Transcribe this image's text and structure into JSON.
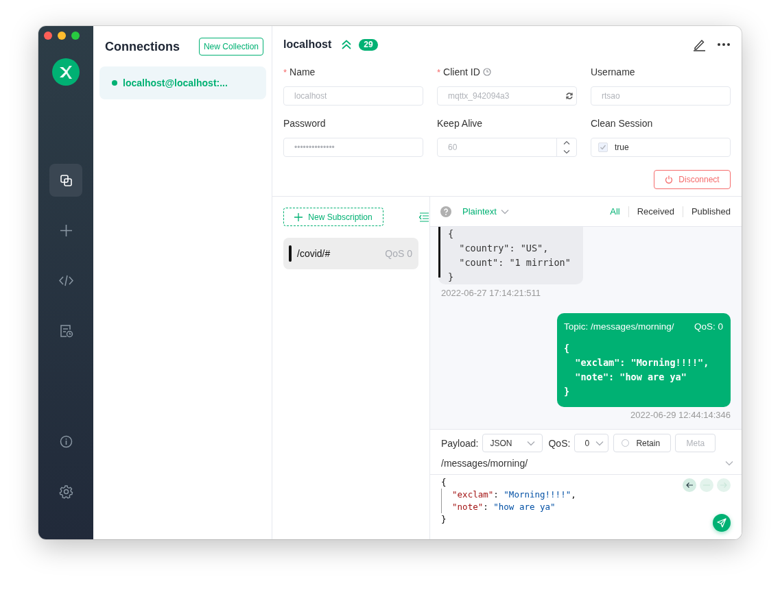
{
  "sidebar": {
    "nav": [
      {
        "selected": true
      },
      {
        "selected": false
      },
      {
        "selected": false
      },
      {
        "selected": false
      }
    ],
    "bottom": [
      {
        "selected": false
      },
      {
        "selected": false
      }
    ]
  },
  "connections": {
    "title": "Connections",
    "new_button": "New Collection",
    "items": [
      {
        "label": "localhost@localhost:...",
        "selected": true,
        "connected": true
      }
    ]
  },
  "connection": {
    "title": "localhost",
    "count": "29",
    "fields": [
      {
        "kind": "text",
        "required_mark": "*",
        "label": "Name",
        "value": "localhost",
        "disabled": true
      },
      {
        "kind": "client-id",
        "required_mark": "*",
        "label": "Client ID",
        "value": "mqttx_942094a3",
        "disabled": true
      },
      {
        "kind": "text",
        "label": "Username",
        "value": "rtsao",
        "disabled": true
      },
      {
        "kind": "text",
        "label": "Password",
        "value": "••••••••••••••",
        "disabled": true
      },
      {
        "kind": "number",
        "label": "Keep Alive",
        "value": "60",
        "disabled": true
      },
      {
        "kind": "checkbox",
        "label": "Clean Session",
        "value": "true",
        "checked": true,
        "disabled": true
      }
    ],
    "disconnect_button": "Disconnect"
  },
  "subscriptions": {
    "new_button": "New Subscription",
    "items": [
      {
        "topic": "/covid/#",
        "qos": "QoS 0",
        "color": "#111111",
        "selected": true
      }
    ]
  },
  "messages": {
    "format": "Plaintext",
    "filters": [
      {
        "label": "All",
        "selected": true
      },
      {
        "label": "Received",
        "selected": false
      },
      {
        "label": "Published",
        "selected": false
      }
    ],
    "items": [
      {
        "kind": "received",
        "payload": "{\n  \"country\": \"US\",\n  \"count\": \"1 mirrion\"\n}",
        "time": "2022-06-27 17:14:21:511"
      },
      {
        "kind": "sent",
        "topic": "Topic: /messages/morning/",
        "qos": "QoS: 0",
        "payload": "{\n  \"exclam\": \"Morning!!!!\",\n  \"note\": \"how are ya\"\n}",
        "time": "2022-06-29 12:44:14:346"
      }
    ]
  },
  "composer": {
    "payload_label": "Payload:",
    "payload_format": "JSON",
    "qos_label": "QoS:",
    "qos": "0",
    "retain": {
      "label": "Retain",
      "checked": false
    },
    "meta": {
      "label": "Meta",
      "disabled": true
    },
    "topic": "/messages/morning/",
    "history_buttons": [
      {
        "disabled": false
      },
      {
        "disabled": true
      },
      {
        "disabled": true
      }
    ],
    "lines": [
      "{",
      "  \"exclam\": \"Morning!!!!\",",
      "  \"note\": \"how are ya\"",
      "}"
    ]
  }
}
